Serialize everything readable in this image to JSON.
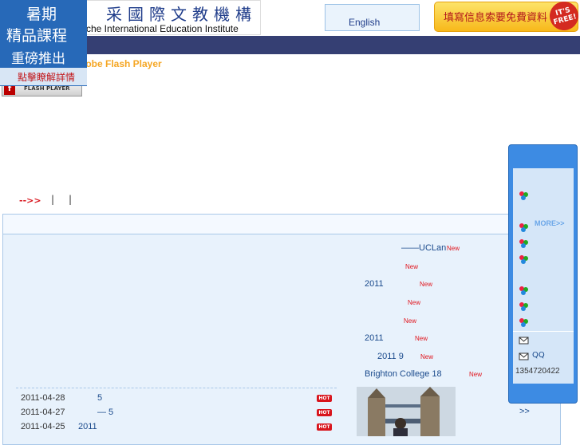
{
  "header": {
    "logo_cn": "采國際文教機構",
    "logo_en": "che International Education Institute",
    "lang_label": "English",
    "free_banner": "填寫信息索要免費資料",
    "free_badge": "IT'S FREE!"
  },
  "flash": {
    "text": "dobe Flash Player",
    "icon_label": "FLASH PLAYER"
  },
  "promo": {
    "line1": "暑期",
    "line2": "精品課程",
    "line3": "重磅推出",
    "line4": "點擊瞭解詳情"
  },
  "breadcrumb": {
    "arrow": "-->>",
    "sep1": "|",
    "sep2": "|"
  },
  "news_right": [
    {
      "text": "——UCLan",
      "new": "New"
    },
    {
      "text": "",
      "new": "New"
    },
    {
      "text": "2011",
      "new": "New"
    },
    {
      "text": "",
      "new": "New"
    },
    {
      "text": "",
      "new": "New"
    },
    {
      "text": "2011",
      "new": "New"
    },
    {
      "text": "2011 9",
      "new": "New"
    },
    {
      "text": "Brighton College 18",
      "new": "New"
    }
  ],
  "news_left": [
    {
      "date": "2011-04-28",
      "text": "5",
      "badge": "HOT"
    },
    {
      "date": "2011-04-27",
      "text": "—        5",
      "badge": "HOT"
    },
    {
      "date": "2011-04-25",
      "text": "2011",
      "badge": "HOT"
    }
  ],
  "sidebar": {
    "more": "MORE>>",
    "qq": "QQ",
    "phone": "1354720422",
    "colors": {
      "outer": "#3d8be3",
      "inner": "#d5e6f8"
    }
  },
  "footer": {
    "more_link": ">>"
  }
}
